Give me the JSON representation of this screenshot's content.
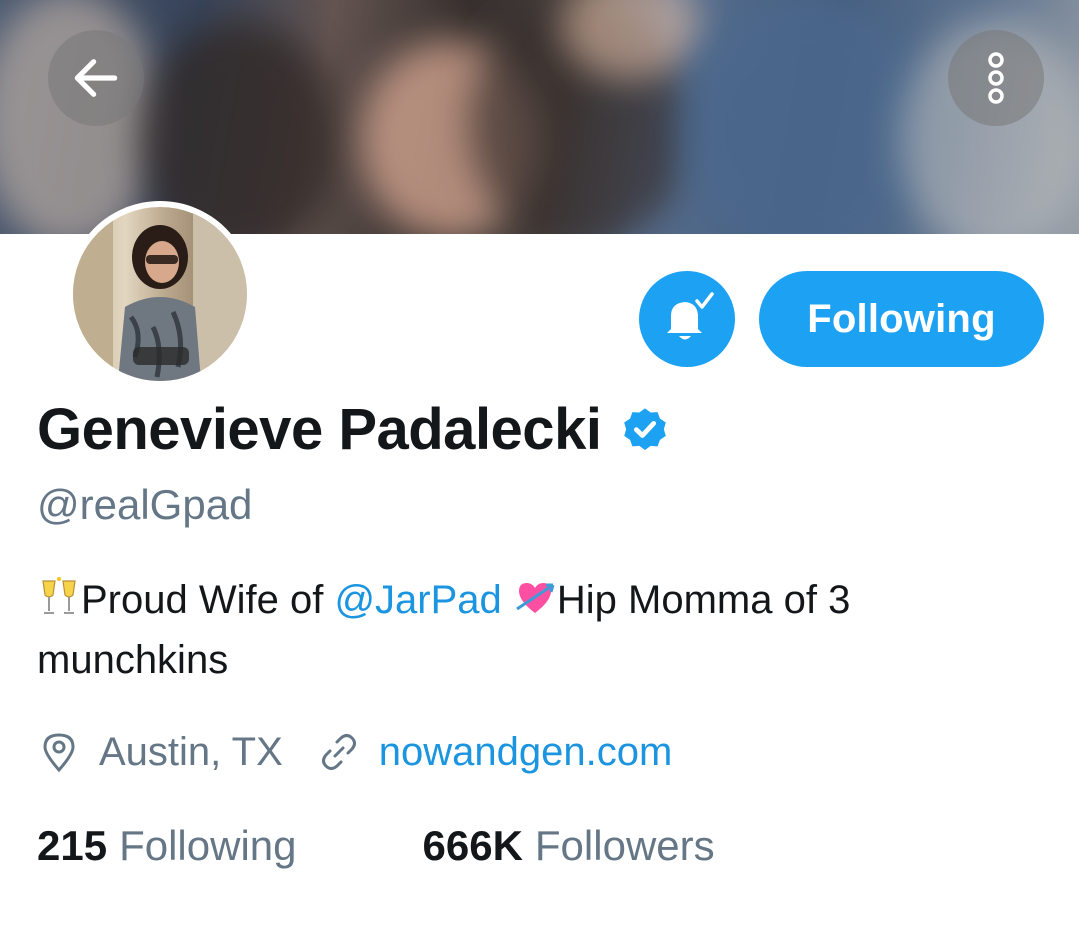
{
  "profile": {
    "display_name": "Genevieve Padalecki",
    "handle": "@realGpad",
    "follow_button_label": "Following",
    "bio": {
      "part1": "Proud Wife of ",
      "mention": "@JarPad",
      "part2": "Hip Momma of 3 munchkins"
    },
    "location": "Austin, TX",
    "website": "nowandgen.com",
    "stats": {
      "following_count": "215",
      "following_label": "Following",
      "followers_count": "666K",
      "followers_label": "Followers"
    }
  },
  "icons": {
    "back": "back-arrow-icon",
    "more": "more-vertical-icon",
    "notifications": "bell-check-icon",
    "verified": "verified-badge-icon",
    "location": "location-pin-icon",
    "link": "link-icon"
  },
  "colors": {
    "accent": "#1da1f2",
    "link": "#1b95e0",
    "secondary_text": "#657786",
    "primary_text": "#14171a"
  }
}
